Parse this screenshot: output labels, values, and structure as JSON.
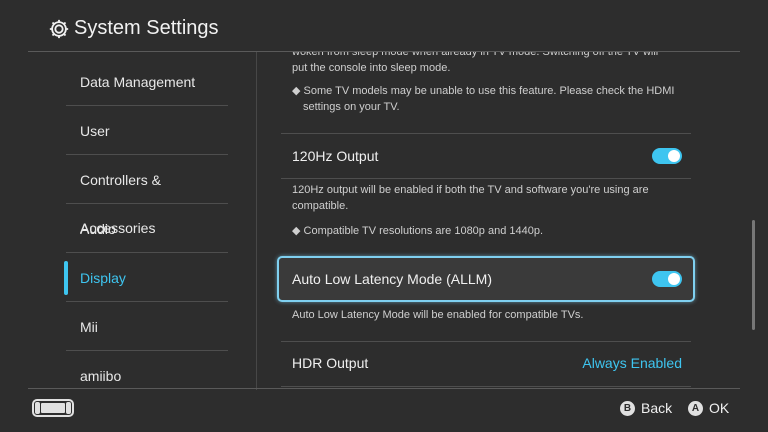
{
  "header": {
    "title": "System Settings"
  },
  "sidebar": {
    "items": [
      {
        "label": "Data Management"
      },
      {
        "label": "User"
      },
      {
        "label": "Controllers & Accessories"
      },
      {
        "label": "Audio"
      },
      {
        "label": "Display"
      },
      {
        "label": "Mii"
      },
      {
        "label": "amiibo"
      }
    ],
    "active_item": "Display"
  },
  "content": {
    "tv_mode_text_line1": "woken from sleep mode when already in TV mode. Switching off the TV will",
    "tv_mode_text_line2": "put the console into sleep mode.",
    "hdmi_note_line1": "◆ Some TV models may be unable to use this feature. Please check the HDMI",
    "hdmi_note_line2": "settings on your TV.",
    "hz120": {
      "label": "120Hz Output",
      "enabled": true,
      "desc_line1": "120Hz output will be enabled if both the TV and software you're using are",
      "desc_line2": "compatible.",
      "note": "◆ Compatible TV resolutions are 1080p and 1440p."
    },
    "allm": {
      "label": "Auto Low Latency Mode (ALLM)",
      "enabled": true,
      "desc": "Auto Low Latency Mode will be enabled for compatible TVs."
    },
    "hdr": {
      "label": "HDR Output",
      "value": "Always Enabled"
    }
  },
  "footer": {
    "back_button": "B",
    "back_label": "Back",
    "ok_button": "A",
    "ok_label": "OK"
  },
  "colors": {
    "accent": "#3ec5f0",
    "background": "#2d2d2d"
  }
}
